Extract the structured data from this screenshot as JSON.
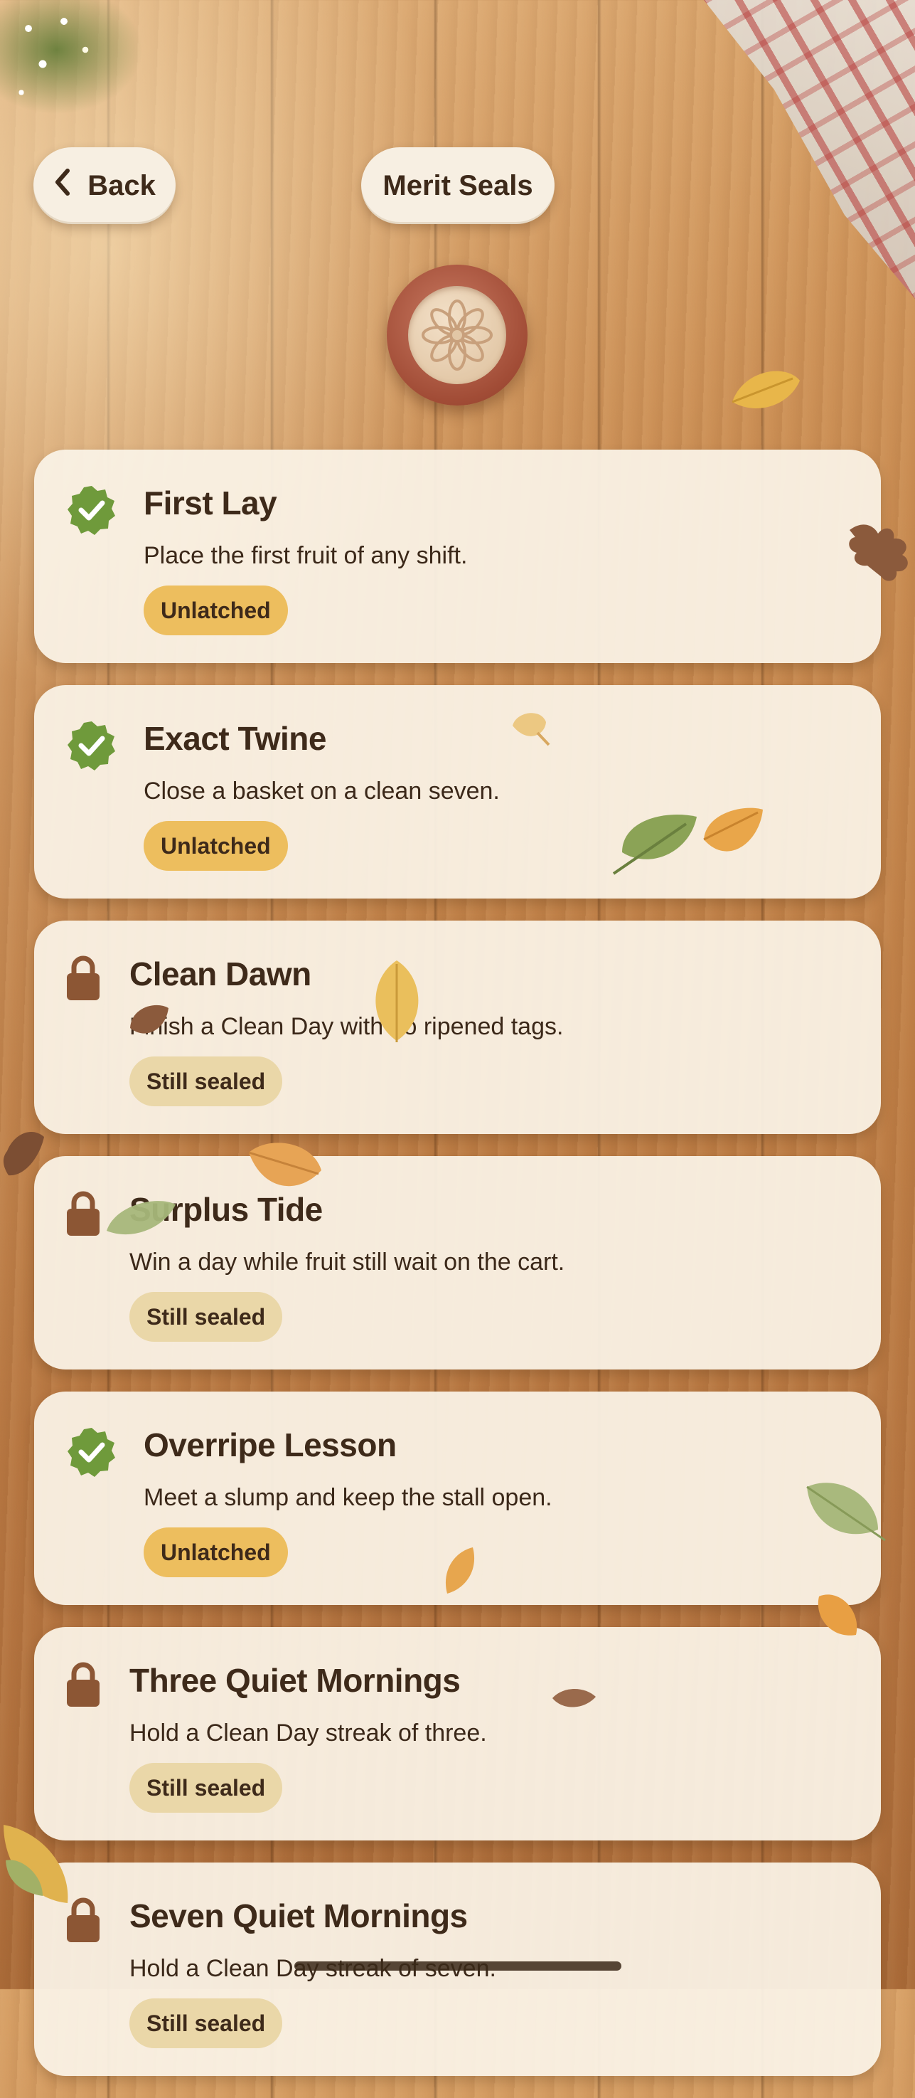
{
  "header": {
    "back_label": "Back",
    "title": "Merit Seals"
  },
  "colors": {
    "unlocked_check": "#6f9a3b",
    "lock": "#8c5634",
    "badge_unlatched": "#edbe5e",
    "badge_sealed": "#ead7a8",
    "card_bg": "#faf2e6",
    "text": "#3e2a1a"
  },
  "seals": [
    {
      "title": "First Lay",
      "description": "Place the first fruit of any shift.",
      "status": "Unlatched",
      "icon": "check-badge-icon"
    },
    {
      "title": "Exact Twine",
      "description": "Close a basket on a clean seven.",
      "status": "Unlatched",
      "icon": "check-badge-icon"
    },
    {
      "title": "Clean Dawn",
      "description": "Finish a Clean Day with no ripened tags.",
      "status": "Still sealed",
      "icon": "lock-icon"
    },
    {
      "title": "Surplus Tide",
      "description": "Win a day while fruit still wait on the cart.",
      "status": "Still sealed",
      "icon": "lock-icon"
    },
    {
      "title": "Overripe Lesson",
      "description": "Meet a slump and keep the stall open.",
      "status": "Unlatched",
      "icon": "check-badge-icon"
    },
    {
      "title": "Three Quiet Mornings",
      "description": "Hold a Clean Day streak of three.",
      "status": "Still sealed",
      "icon": "lock-icon"
    },
    {
      "title": "Seven Quiet Mornings",
      "description": "Hold a Clean Day streak of seven.",
      "status": "Still sealed",
      "icon": "lock-icon"
    }
  ]
}
